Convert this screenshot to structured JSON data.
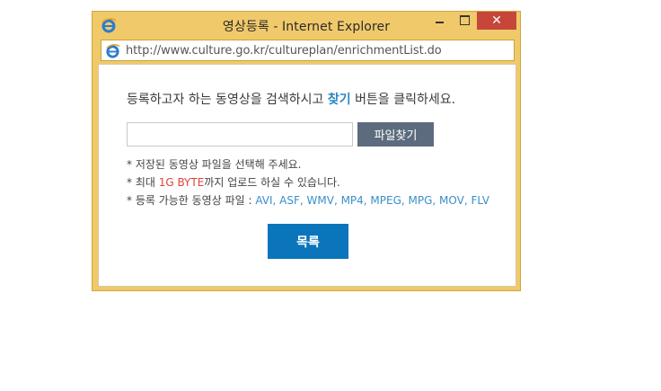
{
  "window": {
    "title": "영상등록 - Internet Explorer",
    "close_symbol": "✕"
  },
  "address": {
    "url": "http://www.culture.go.kr/cultureplan/enrichmentList.do"
  },
  "instruction": {
    "prefix": "등록하고자 하는 동영상을 검색하시고 ",
    "highlight": "찾기",
    "suffix": " 버튼을 클릭하세요."
  },
  "file_input": {
    "value": ""
  },
  "find_button": {
    "label": "파일찾기"
  },
  "notes": {
    "note1": "* 저장된 동영상 파일을 선택해 주세요.",
    "note2_prefix": "* 최대 ",
    "note2_highlight": "1G BYTE",
    "note2_suffix": "까지 업로드 하실 수 있습니다.",
    "note3_prefix": "* 등록 가능한 동영상 파일 : ",
    "note3_formats": "AVI, ASF, WMV, MP4, MPEG, MPG, MOV, FLV"
  },
  "list_button": {
    "label": "목록"
  },
  "colors": {
    "titlebar": "#f0c96a",
    "close": "#c7463a",
    "highlight_blue": "#2e86c1",
    "size_red": "#e0443a",
    "list_button": "#0a75bb",
    "find_button": "#5c6c7e"
  },
  "icons": {
    "browser": "ie-icon",
    "minimize": "minimize-icon",
    "maximize": "maximize-icon",
    "close": "close-icon"
  }
}
